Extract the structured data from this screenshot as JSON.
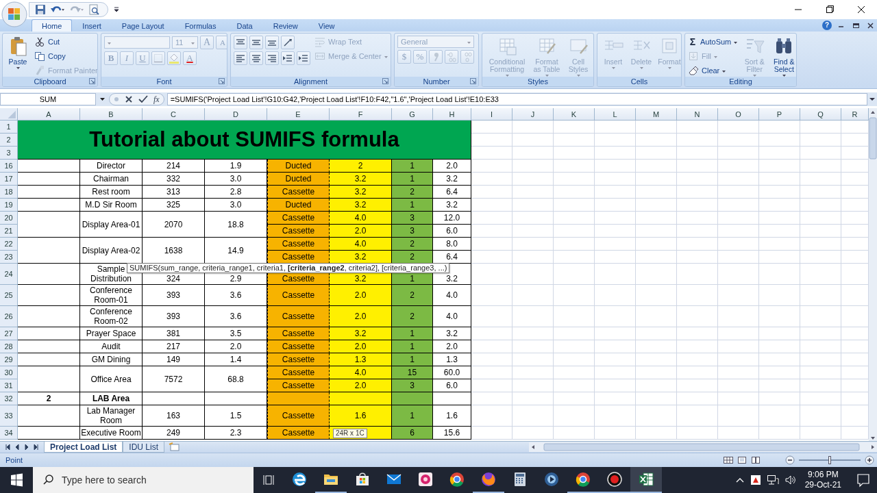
{
  "ribbon_tabs": [
    {
      "label": "Home",
      "selected": true
    },
    {
      "label": "Insert",
      "selected": false
    },
    {
      "label": "Page Layout",
      "selected": false
    },
    {
      "label": "Formulas",
      "selected": false
    },
    {
      "label": "Data",
      "selected": false
    },
    {
      "label": "Review",
      "selected": false
    },
    {
      "label": "View",
      "selected": false
    }
  ],
  "help": "?",
  "ribbon": [
    {
      "label": "Clipboard",
      "launcher": true,
      "sections": [
        {
          "rows": [
            [
              {
                "kind": "paste",
                "label": "Paste",
                "disabled": false
              }
            ]
          ]
        },
        {
          "rows": [
            [
              {
                "kind": "cut",
                "label": "Cut",
                "disabled": false
              }
            ],
            [
              {
                "kind": "copy",
                "label": "Copy",
                "disabled": false
              }
            ],
            [
              {
                "kind": "painter",
                "label": "Format Painter",
                "disabled": true
              }
            ]
          ]
        }
      ]
    },
    {
      "label": "Font",
      "launcher": true,
      "sections": [
        {
          "rows": [
            [
              {
                "kind": "fontname",
                "disabled": true
              },
              {
                "kind": "fontsize",
                "value": "11",
                "disabled": true
              },
              {
                "kind": "grow",
                "label": "A",
                "disabled": true
              },
              {
                "kind": "shrink",
                "label": "A",
                "disabled": true
              }
            ],
            [
              {
                "kind": "bold",
                "label": "B",
                "disabled": true
              },
              {
                "kind": "italic",
                "label": "I",
                "disabled": true
              },
              {
                "kind": "underline",
                "label": "U",
                "disabled": true
              },
              {
                "kind": "border",
                "disabled": true
              },
              {
                "kind": "fillcolor",
                "disabled": true
              },
              {
                "kind": "fontcolor",
                "label": "A",
                "disabled": true
              }
            ]
          ]
        }
      ]
    },
    {
      "label": "Alignment",
      "launcher": true,
      "sections": [
        {
          "rows": [
            [
              {
                "kind": "aligntop",
                "disabled": false
              },
              {
                "kind": "alignmid",
                "disabled": false
              },
              {
                "kind": "alignbottom",
                "disabled": false
              },
              {
                "kind": "orient",
                "disabled": false
              }
            ],
            [
              {
                "kind": "alignleft",
                "disabled": false
              },
              {
                "kind": "aligncenter",
                "disabled": false
              },
              {
                "kind": "alignright",
                "disabled": false
              },
              {
                "kind": "outdent",
                "disabled": false
              },
              {
                "kind": "indent",
                "disabled": false
              }
            ]
          ]
        },
        {
          "rows": [
            [
              {
                "kind": "wrap",
                "label": "Wrap Text",
                "disabled": true
              }
            ],
            [
              {
                "kind": "merge",
                "label": "Merge & Center",
                "disabled": true
              }
            ]
          ]
        }
      ]
    },
    {
      "label": "Number",
      "launcher": true,
      "sections": [
        {
          "rows": [
            [
              {
                "kind": "format",
                "value": "General",
                "disabled": true
              }
            ],
            [
              {
                "kind": "currency",
                "label": "$",
                "disabled": true
              },
              {
                "kind": "percent",
                "label": "%",
                "disabled": true
              },
              {
                "kind": "comma",
                "disabled": true
              },
              {
                "kind": "incdec",
                "disabled": true
              },
              {
                "kind": "decdec",
                "disabled": true
              }
            ]
          ]
        }
      ]
    },
    {
      "label": "Styles",
      "launcher": false,
      "sections": [
        {
          "rows": [
            [
              {
                "kind": "condfmt",
                "label": "Conditional Formatting",
                "disabled": true
              },
              {
                "kind": "table",
                "label": "Format as Table",
                "disabled": true
              },
              {
                "kind": "styles",
                "label": "Cell Styles",
                "disabled": true
              }
            ]
          ]
        }
      ]
    },
    {
      "label": "Cells",
      "launcher": false,
      "sections": [
        {
          "rows": [
            [
              {
                "kind": "insert",
                "label": "Insert",
                "disabled": true
              },
              {
                "kind": "delete",
                "label": "Delete",
                "disabled": true
              },
              {
                "kind": "cellformat",
                "label": "Format",
                "disabled": true
              }
            ]
          ]
        }
      ]
    },
    {
      "label": "Editing",
      "launcher": false,
      "sections": [
        {
          "rows": [
            [
              {
                "kind": "autosum",
                "glyph": "Σ",
                "label": "AutoSum",
                "disabled": false
              }
            ],
            [
              {
                "kind": "fill",
                "label": "Fill",
                "disabled": true
              }
            ],
            [
              {
                "kind": "clear",
                "label": "Clear",
                "disabled": false
              }
            ]
          ]
        },
        {
          "rows": [
            [
              {
                "kind": "sort",
                "label": "Sort & Filter",
                "disabled": true
              },
              {
                "kind": "find",
                "label": "Find & Select",
                "disabled": false
              }
            ]
          ]
        }
      ]
    }
  ],
  "formula_bar": {
    "name_box": "SUM",
    "function_button": "fx",
    "formula": "=SUMIFS('Project Load List'!G10:G42,'Project Load List'!F10:F42,\"1.6\",'Project Load List'!E10:E33"
  },
  "columns": [
    {
      "label": "A"
    },
    {
      "label": "B"
    },
    {
      "label": "C"
    },
    {
      "label": "D"
    },
    {
      "label": "E",
      "color": "#f7b300",
      "marquee": true
    },
    {
      "label": "F",
      "color": "#fff000"
    },
    {
      "label": "G",
      "color": "#7cba44"
    },
    {
      "label": "H"
    },
    {
      "label": "I"
    },
    {
      "label": "J"
    },
    {
      "label": "K"
    },
    {
      "label": "L"
    },
    {
      "label": "M"
    },
    {
      "label": "N"
    },
    {
      "label": "O"
    },
    {
      "label": "P"
    },
    {
      "label": "Q"
    },
    {
      "label": "R"
    }
  ],
  "rows": [
    {
      "number": "1",
      "cells": [
        {
          "kind": "banner",
          "text": "Tutorial about SUMIFS formula",
          "rowspan": 3,
          "colspan": 8
        }
      ]
    },
    {
      "number": "2"
    },
    {
      "number": "3"
    },
    {
      "number": "16",
      "cells": [
        null,
        {
          "text": "Director"
        },
        {
          "text": "214"
        },
        {
          "text": "1.9"
        },
        {
          "text": "Ducted"
        },
        {
          "text": "2"
        },
        {
          "text": "1"
        },
        {
          "text": "2.0"
        }
      ]
    },
    {
      "number": "17",
      "cells": [
        null,
        {
          "text": "Chairman"
        },
        {
          "text": "332"
        },
        {
          "text": "3.0"
        },
        {
          "text": "Ducted"
        },
        {
          "text": "3.2"
        },
        {
          "text": "1"
        },
        {
          "text": "3.2"
        }
      ]
    },
    {
      "number": "18",
      "cells": [
        null,
        {
          "text": "Rest room"
        },
        {
          "text": "313"
        },
        {
          "text": "2.8"
        },
        {
          "text": "Cassette"
        },
        {
          "text": "3.2"
        },
        {
          "text": "2"
        },
        {
          "text": "6.4"
        }
      ]
    },
    {
      "number": "19",
      "cells": [
        null,
        {
          "text": "M.D Sir Room"
        },
        {
          "text": "325"
        },
        {
          "text": "3.0"
        },
        {
          "text": "Ducted"
        },
        {
          "text": "3.2"
        },
        {
          "text": "1"
        },
        {
          "text": "3.2"
        }
      ]
    },
    {
      "number": "20",
      "cells": [
        {
          "rowspan": 2
        },
        {
          "text": "Display Area-01",
          "rowspan": 2
        },
        {
          "text": "2070",
          "rowspan": 2
        },
        {
          "text": "18.8",
          "rowspan": 2
        },
        {
          "text": "Cassette"
        },
        {
          "text": "4.0"
        },
        {
          "text": "3"
        },
        {
          "text": "12.0"
        }
      ]
    },
    {
      "number": "21",
      "cells": [
        {
          "text": "Cassette"
        },
        {
          "text": "2.0"
        },
        {
          "text": "3"
        },
        {
          "text": "6.0"
        }
      ]
    },
    {
      "number": "22",
      "cells": [
        {
          "rowspan": 2
        },
        {
          "text": "Display Area-02",
          "rowspan": 2
        },
        {
          "text": "1638",
          "rowspan": 2
        },
        {
          "text": "14.9",
          "rowspan": 2
        },
        {
          "text": "Cassette"
        },
        {
          "text": "4.0"
        },
        {
          "text": "2"
        },
        {
          "text": "8.0"
        }
      ]
    },
    {
      "number": "23",
      "cells": [
        {
          "text": "Cassette"
        },
        {
          "text": "3.2"
        },
        {
          "text": "2"
        },
        {
          "text": "6.4"
        }
      ]
    },
    {
      "number": "24",
      "tooltip": {
        "kind": "function",
        "text": "SUMIFS(sum_range, criteria_range1, criteria1, **[criteria_range2**, criteria2], [criteria_range3, ...)"
      },
      "cells": [
        null,
        {
          "text": "Sample Distribution"
        },
        {
          "text": "324"
        },
        {
          "text": "2.9"
        },
        {
          "text": "Cassette"
        },
        {
          "text": "3.2"
        },
        {
          "text": "1"
        },
        {
          "text": "3.2"
        }
      ]
    },
    {
      "number": "25",
      "cells": [
        null,
        {
          "text": "Conference Room-01"
        },
        {
          "text": "393"
        },
        {
          "text": "3.6"
        },
        {
          "text": "Cassette"
        },
        {
          "text": "2.0"
        },
        {
          "text": "2"
        },
        {
          "text": "4.0"
        }
      ]
    },
    {
      "number": "26",
      "cells": [
        null,
        {
          "text": "Conference Room-02"
        },
        {
          "text": "393"
        },
        {
          "text": "3.6"
        },
        {
          "text": "Cassette"
        },
        {
          "text": "2.0"
        },
        {
          "text": "2"
        },
        {
          "text": "4.0"
        }
      ]
    },
    {
      "number": "27",
      "cells": [
        null,
        {
          "text": "Prayer Space"
        },
        {
          "text": "381"
        },
        {
          "text": "3.5"
        },
        {
          "text": "Cassette"
        },
        {
          "text": "3.2"
        },
        {
          "text": "1"
        },
        {
          "text": "3.2"
        }
      ]
    },
    {
      "number": "28",
      "cells": [
        null,
        {
          "text": "Audit"
        },
        {
          "text": "217"
        },
        {
          "text": "2.0"
        },
        {
          "text": "Cassette"
        },
        {
          "text": "2.0"
        },
        {
          "text": "1"
        },
        {
          "text": "2.0"
        }
      ]
    },
    {
      "number": "29",
      "cells": [
        null,
        {
          "text": "GM Dining"
        },
        {
          "text": "149"
        },
        {
          "text": "1.4"
        },
        {
          "text": "Cassette"
        },
        {
          "text": "1.3"
        },
        {
          "text": "1"
        },
        {
          "text": "1.3"
        }
      ]
    },
    {
      "number": "30",
      "cells": [
        {
          "rowspan": 2
        },
        {
          "text": "Office Area",
          "rowspan": 2
        },
        {
          "text": "7572",
          "rowspan": 2
        },
        {
          "text": "68.8",
          "rowspan": 2
        },
        {
          "text": "Cassette"
        },
        {
          "text": "4.0"
        },
        {
          "text": "15"
        },
        {
          "text": "60.0"
        }
      ]
    },
    {
      "number": "31",
      "cells": [
        {
          "text": "Cassette"
        },
        {
          "text": "2.0"
        },
        {
          "text": "3"
        },
        {
          "text": "6.0"
        }
      ]
    },
    {
      "number": "32",
      "cells": [
        {
          "text": "2",
          "bold": true
        },
        {
          "text": "LAB Area",
          "bold": true
        },
        null,
        null,
        null,
        null,
        null,
        null
      ]
    },
    {
      "number": "33",
      "cells": [
        null,
        {
          "text": "Lab Manager Room"
        },
        {
          "text": "163"
        },
        {
          "text": "1.5"
        },
        {
          "text": "Cassette"
        },
        {
          "text": "1.6"
        },
        {
          "text": "1"
        },
        {
          "text": "1.6"
        }
      ]
    },
    {
      "number": "34",
      "tooltip": {
        "kind": "size",
        "text": "24R x 1C"
      },
      "cells": [
        null,
        {
          "text": "Executive Room"
        },
        {
          "text": "249"
        },
        {
          "text": "2.3"
        },
        {
          "text": "Cassette"
        },
        null,
        {
          "text": "6"
        },
        {
          "text": "15.6"
        }
      ]
    }
  ],
  "sheet_tabs": [
    {
      "label": "Project Load List",
      "selected": true
    },
    {
      "label": "IDU List",
      "selected": false
    }
  ],
  "status_bar": {
    "mode": "Point",
    "zoom_slider": {
      "level": 0.5
    }
  },
  "taskbar": {
    "search": {
      "placeholder": "Type here to search"
    },
    "apps": [
      {
        "kind": "ebrowser",
        "running": false,
        "active": false
      },
      {
        "kind": "folder",
        "running": true,
        "active": false
      },
      {
        "kind": "bag",
        "running": false,
        "active": false
      },
      {
        "kind": "mail",
        "running": false,
        "active": false
      },
      {
        "kind": "flower",
        "running": false,
        "active": false
      },
      {
        "kind": "wheel",
        "running": false,
        "active": false
      },
      {
        "kind": "fox",
        "running": true,
        "active": false
      },
      {
        "kind": "calculator",
        "running": false,
        "active": false
      },
      {
        "kind": "disc",
        "running": false,
        "active": false
      },
      {
        "kind": "wheel",
        "running": true,
        "active": false
      },
      {
        "kind": "record",
        "running": true,
        "active": false
      },
      {
        "kind": "sheet",
        "running": true,
        "active": true
      }
    ],
    "time": "9:06 PM",
    "date": "29-Oct-21"
  }
}
